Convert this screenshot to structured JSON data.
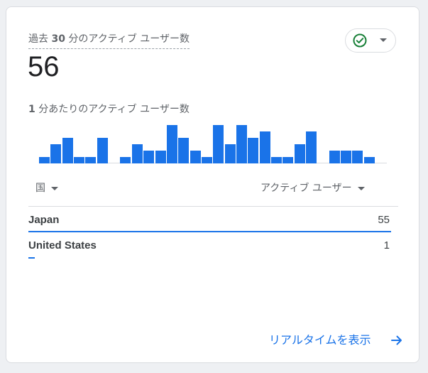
{
  "card": {
    "title_prefix": "過去 ",
    "title_number": "30",
    "title_suffix": " 分のアクティブ ユーザー数",
    "active_users": "56",
    "status_icon": "check-circle-icon",
    "status_color": "#188038",
    "subtitle_number": "1",
    "subtitle_text": " 分あたりのアクティブ ユーザー数"
  },
  "chart_data": {
    "type": "bar",
    "per_minute_active_users": [
      1,
      3,
      4,
      1,
      1,
      4,
      0,
      1,
      3,
      2,
      2,
      6,
      4,
      2,
      1,
      6,
      3,
      6,
      4,
      5,
      1,
      1,
      3,
      5,
      0,
      2,
      2,
      2,
      1
    ],
    "color": "#1a73e8"
  },
  "table": {
    "dimension_header": "国",
    "metric_header": "アクティブ ユーザー",
    "rows": [
      {
        "country": "Japan",
        "value": "55",
        "share": 1.0
      },
      {
        "country": "United States",
        "value": "1",
        "share": 0.018
      }
    ]
  },
  "footer": {
    "link_label": "リアルタイムを表示",
    "link_icon": "arrow-right-icon"
  }
}
